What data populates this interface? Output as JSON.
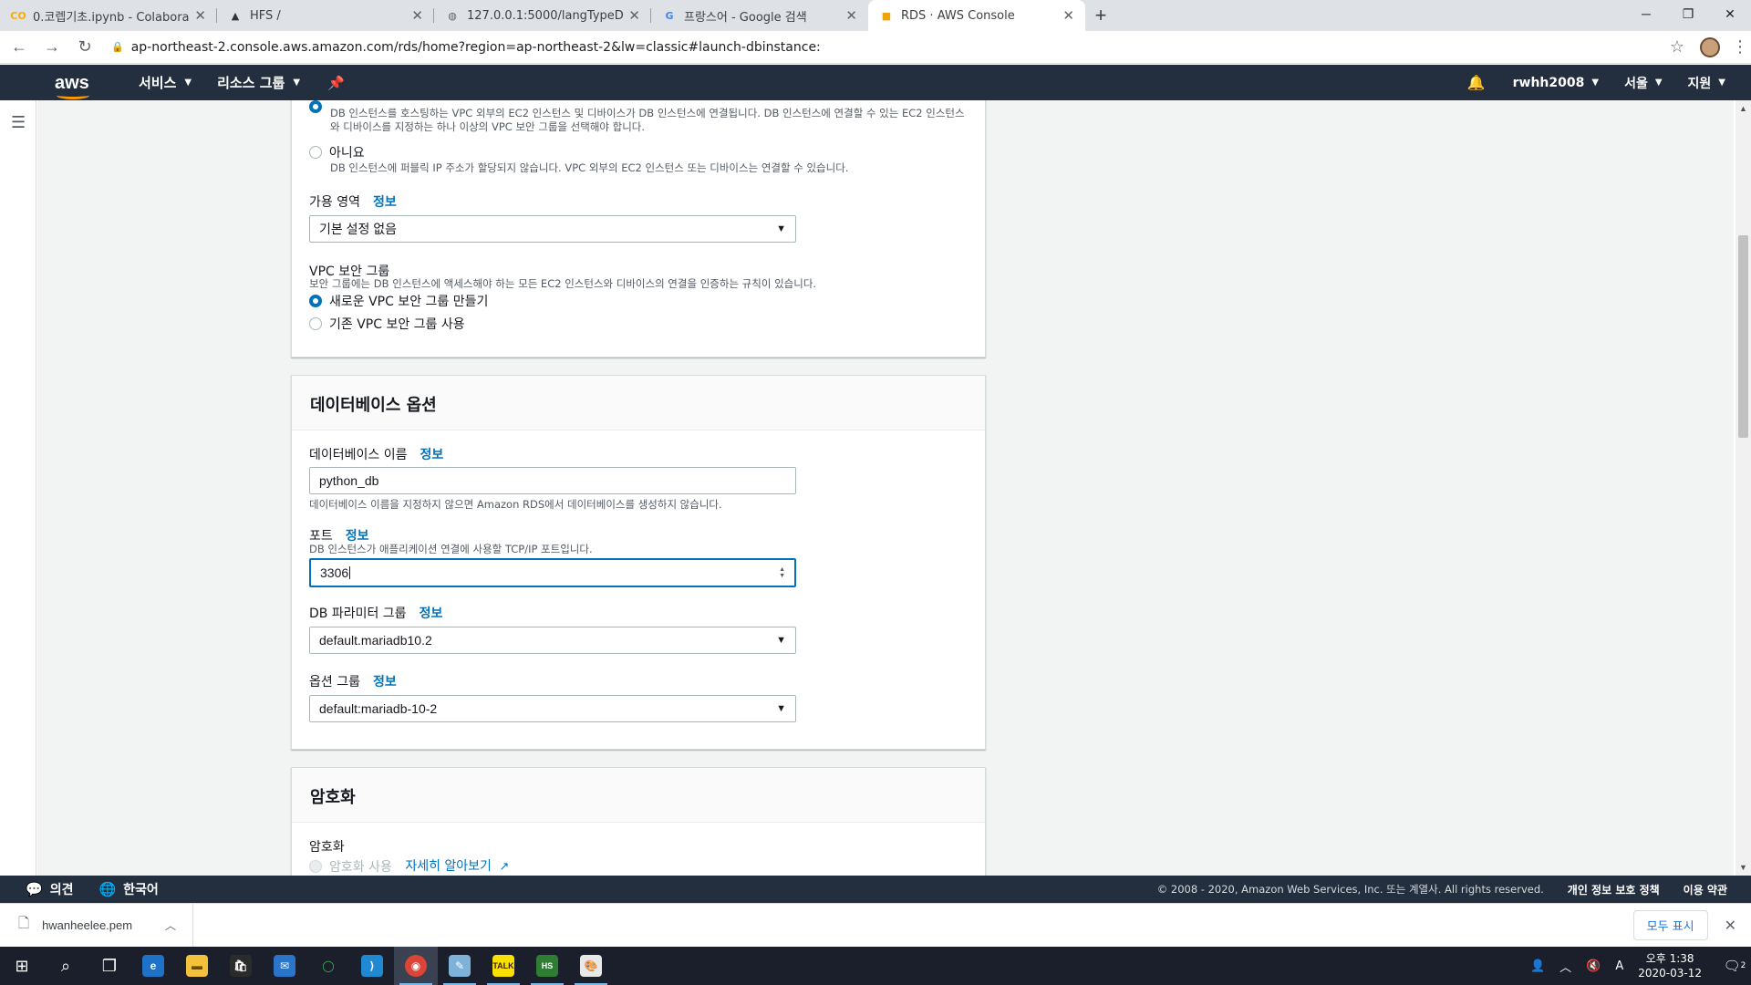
{
  "browser": {
    "tabs": [
      {
        "title": "0.코렙기초.ipynb - Colaboratory",
        "icon": "CO"
      },
      {
        "title": "HFS /",
        "icon": "HFS"
      },
      {
        "title": "127.0.0.1:5000/langTypeDetect",
        "icon": "globe"
      },
      {
        "title": "프랑스어 - Google 검색",
        "icon": "G"
      },
      {
        "title": "RDS · AWS Console",
        "icon": "box"
      }
    ],
    "url": "ap-northeast-2.console.aws.amazon.com/rds/home?region=ap-northeast-2&lw=classic#launch-dbinstance:"
  },
  "aws_nav": {
    "logo": "aws",
    "services": "서비스",
    "resource_groups": "리소스 그룹",
    "user": "rwhh2008",
    "region": "서울",
    "support": "지원"
  },
  "connectivity": {
    "public_yes_desc": "DB 인스턴스를 호스팅하는 VPC 외부의 EC2 인스턴스 및 디바이스가 DB 인스턴스에 연결됩니다. DB 인스턴스에 연결할 수 있는 EC2 인스턴스와 디바이스를 지정하는 하나 이상의 VPC 보안 그룹을 선택해야 합니다.",
    "public_no_label": "아니요",
    "public_no_desc": "DB 인스턴스에 퍼블릭 IP 주소가 할당되지 않습니다. VPC 외부의 EC2 인스턴스 또는 디바이스는 연결할 수 있습니다.",
    "az_label": "가용 영역",
    "info": "정보",
    "az_value": "기본 설정 없음",
    "vpc_sg_label": "VPC 보안 그룹",
    "vpc_sg_desc": "보안 그룹에는 DB 인스턴스에 액세스해야 하는 모든 EC2 인스턴스와 디바이스의 연결을 인증하는 규칙이 있습니다.",
    "vpc_new": "새로운 VPC 보안 그룹 만들기",
    "vpc_existing": "기존 VPC 보안 그룹 사용"
  },
  "db_options": {
    "title": "데이터베이스 옵션",
    "db_name_label": "데이터베이스 이름",
    "db_name_value": "python_db",
    "db_name_desc": "데이터베이스 이름을 지정하지 않으면 Amazon RDS에서 데이터베이스를 생성하지 않습니다.",
    "port_label": "포트",
    "port_desc": "DB 인스턴스가 애플리케이션 연결에 사용할 TCP/IP 포트입니다.",
    "port_value": "3306",
    "param_group_label": "DB 파라미터 그룹",
    "param_group_value": "default.mariadb10.2",
    "option_group_label": "옵션 그룹",
    "option_group_value": "default:mariadb-10-2"
  },
  "encryption": {
    "title": "암호화",
    "label": "암호화",
    "enable": "암호화 사용",
    "learn_more": "자세히 알아보기"
  },
  "footer": {
    "feedback": "의견",
    "language": "한국어",
    "copyright": "© 2008 - 2020, Amazon Web Services, Inc. 또는 계열사. All rights reserved.",
    "privacy": "개인 정보 보호 정책",
    "terms": "이용 약관"
  },
  "downloads": {
    "file": "hwanheelee.pem",
    "show_all": "모두 표시"
  },
  "taskbar": {
    "time": "오후 1:38",
    "date": "2020-03-12",
    "ime": "A",
    "notifications": "2"
  }
}
